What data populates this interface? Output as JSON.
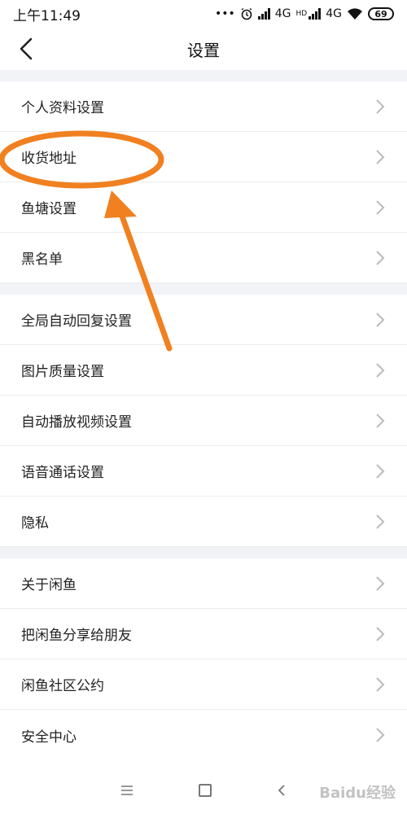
{
  "status": {
    "time": "上午11:49",
    "dots": "•••",
    "net1": "4G",
    "net2": "4G",
    "hd": "HD",
    "battery": "69"
  },
  "header": {
    "title": "设置"
  },
  "groups": [
    {
      "items": [
        "个人资料设置",
        "收货地址",
        "鱼塘设置",
        "黑名单"
      ]
    },
    {
      "items": [
        "全局自动回复设置",
        "图片质量设置",
        "自动播放视频设置",
        "语音通话设置",
        "隐私"
      ]
    },
    {
      "items": [
        "关于闲鱼",
        "把闲鱼分享给朋友",
        "闲鱼社区公约",
        "安全中心"
      ]
    }
  ],
  "annotation": {
    "color": "#f08020",
    "highlight": "收货地址"
  },
  "watermark": "Baidu经验"
}
